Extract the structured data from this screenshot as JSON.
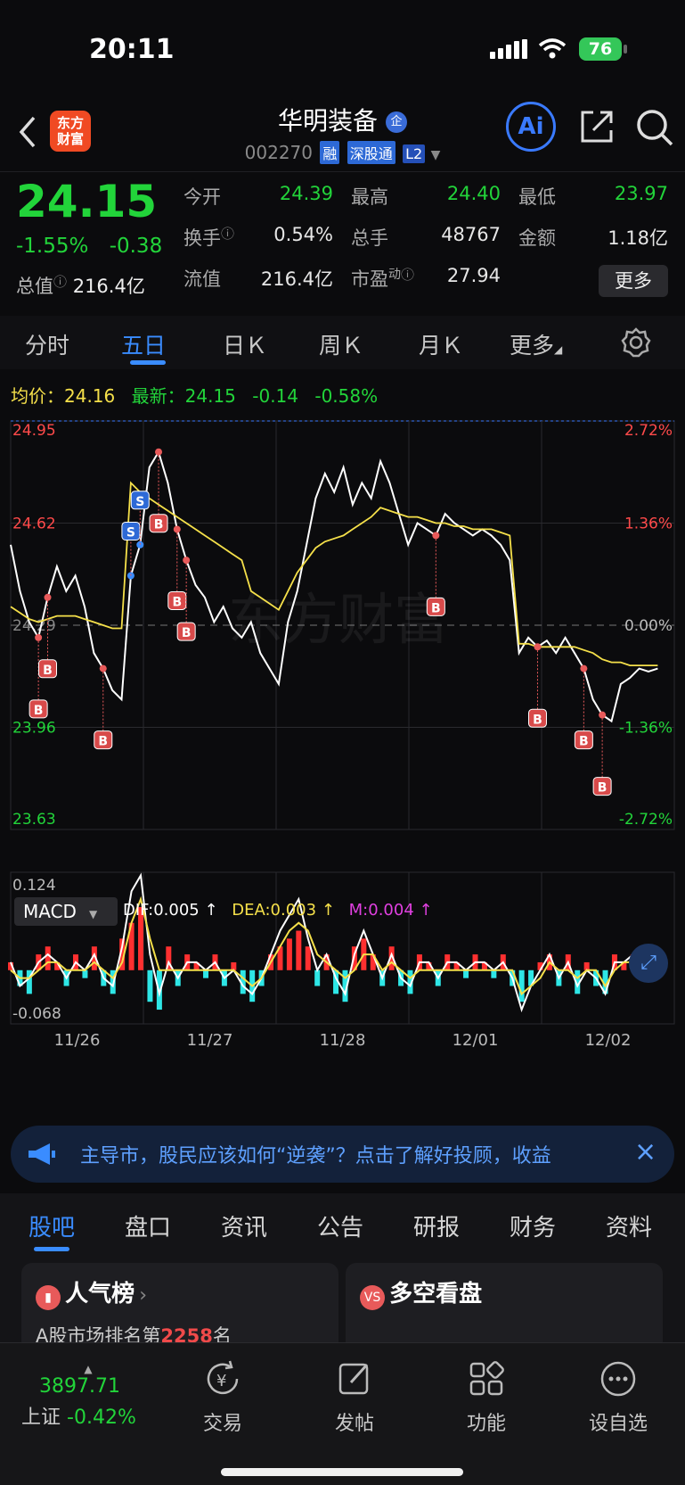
{
  "status_bar": {
    "time": "20:11",
    "battery": "76"
  },
  "header": {
    "logo_text": "东方财富",
    "title": "华明装备",
    "title_badge": "企",
    "code": "002270",
    "tags": [
      "融",
      "深股通",
      "L2"
    ],
    "ai_label": "Ai"
  },
  "quote": {
    "price": "24.15",
    "change_pct": "-1.55%",
    "change_abs": "-0.38",
    "total_value_label": "总值",
    "total_value": "216.4亿",
    "fields": [
      {
        "label": "今开",
        "value": "24.39",
        "color": "#22d43a"
      },
      {
        "label": "最高",
        "value": "24.40",
        "color": "#22d43a"
      },
      {
        "label": "最低",
        "value": "23.97",
        "color": "#22d43a"
      },
      {
        "label": "换手",
        "value": "0.54%",
        "color": "#e6e6e6"
      },
      {
        "label": "总手",
        "value": "48767",
        "color": "#e6e6e6"
      },
      {
        "label": "金额",
        "value": "1.18亿",
        "color": "#e6e6e6"
      },
      {
        "label": "流值",
        "value": "216.4亿",
        "color": "#e6e6e6"
      },
      {
        "label": "市盈",
        "label_sup": "动",
        "value": "27.94",
        "color": "#e6e6e6"
      }
    ],
    "more_button": "更多"
  },
  "tabs": [
    "分时",
    "五日",
    "日Ｋ",
    "周Ｋ",
    "月Ｋ",
    "更多"
  ],
  "active_tab": "五日",
  "info_line": {
    "avg_label": "均价：",
    "avg_value": "24.16",
    "latest_label": "最新：",
    "latest_value": "24.15",
    "latest_change": "-0.14",
    "latest_pct": "-0.58%"
  },
  "chart_data": {
    "type": "line",
    "watermark": "东方财富",
    "price_axis": [
      "24.95",
      "24.62",
      "24.29",
      "23.96",
      "23.63"
    ],
    "pct_axis": [
      "2.72%",
      "1.36%",
      "0.00%",
      "-1.36%",
      "-2.72%"
    ],
    "x_labels": [
      "11/26",
      "11/27",
      "11/28",
      "12/01",
      "12/02"
    ],
    "ylim": [
      23.63,
      24.95
    ],
    "series": [
      {
        "name": "price",
        "color": "#ffffff",
        "values": [
          24.55,
          24.4,
          24.3,
          24.25,
          24.38,
          24.48,
          24.4,
          24.45,
          24.35,
          24.2,
          24.15,
          24.08,
          24.05,
          24.45,
          24.55,
          24.8,
          24.85,
          24.75,
          24.6,
          24.5,
          24.42,
          24.38,
          24.3,
          24.35,
          24.28,
          24.25,
          24.3,
          24.2,
          24.15,
          24.1,
          24.3,
          24.4,
          24.55,
          24.7,
          24.78,
          24.72,
          24.8,
          24.68,
          24.75,
          24.7,
          24.82,
          24.75,
          24.65,
          24.55,
          24.62,
          24.6,
          24.58,
          24.65,
          24.62,
          24.6,
          24.58,
          24.6,
          24.58,
          24.55,
          24.5,
          24.2,
          24.25,
          24.22,
          24.24,
          24.2,
          24.25,
          24.2,
          24.15,
          24.05,
          24.0,
          23.98,
          24.1,
          24.12,
          24.15,
          24.14,
          24.15
        ]
      },
      {
        "name": "average",
        "color": "#f5e04a",
        "values": [
          24.35,
          24.33,
          24.31,
          24.3,
          24.31,
          24.32,
          24.32,
          24.32,
          24.31,
          24.3,
          24.29,
          24.28,
          24.28,
          24.75,
          24.72,
          24.7,
          24.68,
          24.66,
          24.64,
          24.62,
          24.6,
          24.58,
          24.56,
          24.54,
          24.52,
          24.5,
          24.4,
          24.38,
          24.36,
          24.34,
          24.4,
          24.46,
          24.5,
          24.54,
          24.56,
          24.57,
          24.58,
          24.6,
          24.62,
          24.64,
          24.67,
          24.66,
          24.65,
          24.64,
          24.64,
          24.63,
          24.62,
          24.62,
          24.61,
          24.61,
          24.6,
          24.6,
          24.6,
          24.59,
          24.58,
          24.23,
          24.23,
          24.22,
          24.22,
          24.22,
          24.22,
          24.22,
          24.21,
          24.2,
          24.18,
          24.17,
          24.17,
          24.16,
          24.16,
          24.16,
          24.16
        ]
      }
    ],
    "trade_markers": [
      {
        "type": "B",
        "index": 3
      },
      {
        "type": "B",
        "index": 4
      },
      {
        "type": "B",
        "index": 10
      },
      {
        "type": "S",
        "index": 13
      },
      {
        "type": "S",
        "index": 14
      },
      {
        "type": "B",
        "index": 16
      },
      {
        "type": "B",
        "index": 18
      },
      {
        "type": "B",
        "index": 19
      },
      {
        "type": "B",
        "index": 46
      },
      {
        "type": "B",
        "index": 57
      },
      {
        "type": "B",
        "index": 62
      },
      {
        "type": "B",
        "index": 64
      }
    ],
    "macd": {
      "label": "MACD",
      "dif_label": "DIF:0.005 ↑",
      "dea_label": "DEA:0.003 ↑",
      "m_label": "M:0.004 ↑",
      "max_label": "0.124",
      "min_label": "-0.068",
      "ylim": [
        -0.068,
        0.124
      ],
      "histogram": [
        0.01,
        -0.02,
        -0.03,
        0.02,
        0.03,
        0.01,
        -0.02,
        0.02,
        -0.01,
        0.03,
        -0.02,
        -0.03,
        0.04,
        0.06,
        0.08,
        -0.04,
        -0.05,
        0.03,
        -0.02,
        0.02,
        0.01,
        -0.01,
        0.02,
        -0.02,
        0.01,
        -0.03,
        -0.04,
        -0.02,
        0.02,
        0.03,
        0.04,
        0.05,
        0.03,
        -0.02,
        0.02,
        -0.03,
        -0.04,
        0.03,
        0.04,
        0.02,
        -0.02,
        0.03,
        -0.02,
        -0.03,
        0.02,
        0.01,
        -0.02,
        0.02,
        0.01,
        -0.01,
        0.02,
        0.01,
        -0.01,
        0.02,
        -0.02,
        -0.04,
        -0.02,
        0.01,
        0.02,
        -0.02,
        0.02,
        -0.03,
        0.01,
        -0.02,
        -0.03,
        0.02,
        0.01,
        0.02,
        -0.01,
        0.01,
        0.01
      ],
      "dif": [
        0.01,
        -0.02,
        -0.01,
        0.01,
        0.02,
        0.01,
        -0.01,
        0.01,
        0.0,
        0.02,
        -0.01,
        -0.02,
        0.03,
        0.1,
        0.12,
        0.02,
        -0.03,
        0.01,
        -0.01,
        0.01,
        0.01,
        0.0,
        0.01,
        -0.01,
        0.0,
        -0.02,
        -0.03,
        -0.01,
        0.02,
        0.05,
        0.07,
        0.09,
        0.04,
        0.0,
        0.02,
        -0.01,
        -0.03,
        0.02,
        0.05,
        0.02,
        -0.01,
        0.02,
        -0.01,
        -0.02,
        0.01,
        0.01,
        -0.01,
        0.01,
        0.01,
        0.0,
        0.01,
        0.01,
        0.0,
        0.01,
        -0.01,
        -0.05,
        -0.02,
        0.0,
        0.02,
        -0.01,
        0.01,
        -0.02,
        0.0,
        -0.01,
        -0.03,
        0.01,
        0.01,
        0.02,
        0.0,
        0.01,
        0.01
      ],
      "dea": [
        0.0,
        -0.01,
        -0.01,
        0.0,
        0.01,
        0.01,
        0.0,
        0.0,
        0.0,
        0.01,
        0.0,
        -0.01,
        0.01,
        0.06,
        0.09,
        0.04,
        0.0,
        0.0,
        0.0,
        0.0,
        0.0,
        0.0,
        0.0,
        0.0,
        0.0,
        -0.01,
        -0.02,
        -0.01,
        0.01,
        0.03,
        0.05,
        0.06,
        0.05,
        0.02,
        0.01,
        0.0,
        -0.01,
        0.0,
        0.02,
        0.02,
        0.0,
        0.01,
        0.0,
        -0.01,
        0.0,
        0.0,
        0.0,
        0.0,
        0.0,
        0.0,
        0.0,
        0.0,
        0.0,
        0.0,
        0.0,
        -0.03,
        -0.02,
        -0.01,
        0.01,
        0.0,
        0.0,
        -0.01,
        0.0,
        0.0,
        -0.02,
        0.0,
        0.01,
        0.01,
        0.0,
        0.0,
        0.0
      ]
    }
  },
  "banner": {
    "text": "主导市，股民应该如何“逆袭”？点击了解好投顾，收益",
    "close": "×"
  },
  "bottom_tabs": [
    "股吧",
    "盘口",
    "资讯",
    "公告",
    "研报",
    "财务",
    "资料"
  ],
  "active_bottom_tab": "股吧",
  "cards": [
    {
      "title": "人气榜",
      "subtitle_prefix": "A股市场排名第",
      "rank": "2258",
      "subtitle_suffix": "名"
    },
    {
      "title": "多空看盘"
    }
  ],
  "nav": {
    "index_value": "3897.71",
    "index_name": "上证",
    "index_change": "-0.42%",
    "items": [
      "交易",
      "发帖",
      "功能",
      "设自选"
    ]
  }
}
